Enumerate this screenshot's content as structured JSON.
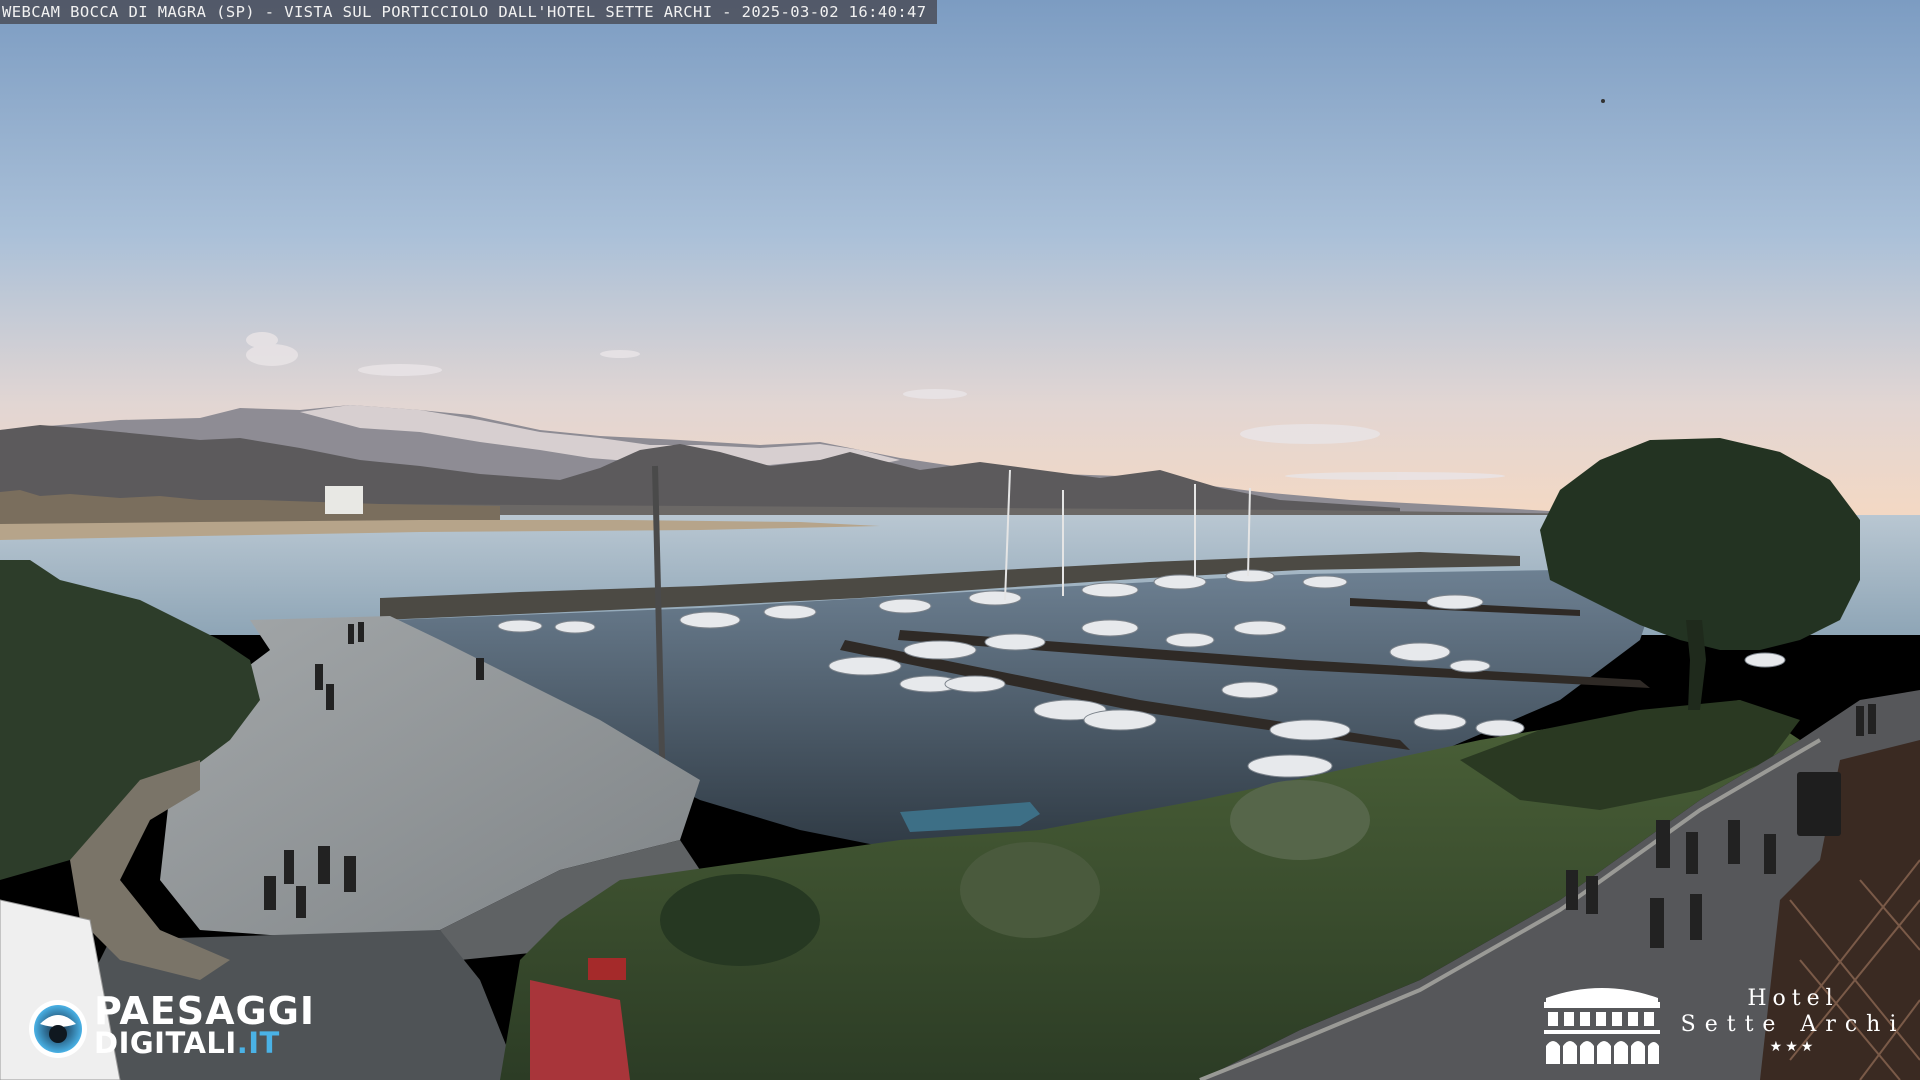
{
  "caption": "WEBCAM BOCCA DI MAGRA (SP) - VISTA SUL PORTICCIOLO DALL'HOTEL SETTE ARCHI - 2025-03-02 16:40:47",
  "logo_left": {
    "line1": "PAESAGGI",
    "line2_main": "DIGITALI",
    "line2_suffix": ".IT",
    "accent_color": "#4ab2e6"
  },
  "logo_right": {
    "line1": "Hotel",
    "line2": "Sette Archi",
    "stars": "★★★"
  },
  "colors": {
    "sky_top": "#7f9fc4",
    "sky_horizon": "#f3d9c6",
    "sea": "#a8bccb",
    "harbor_water": "#3f4e5b",
    "lawn": "#3d5233",
    "promenade": "#8f9498",
    "tree": "#2a3b28"
  }
}
